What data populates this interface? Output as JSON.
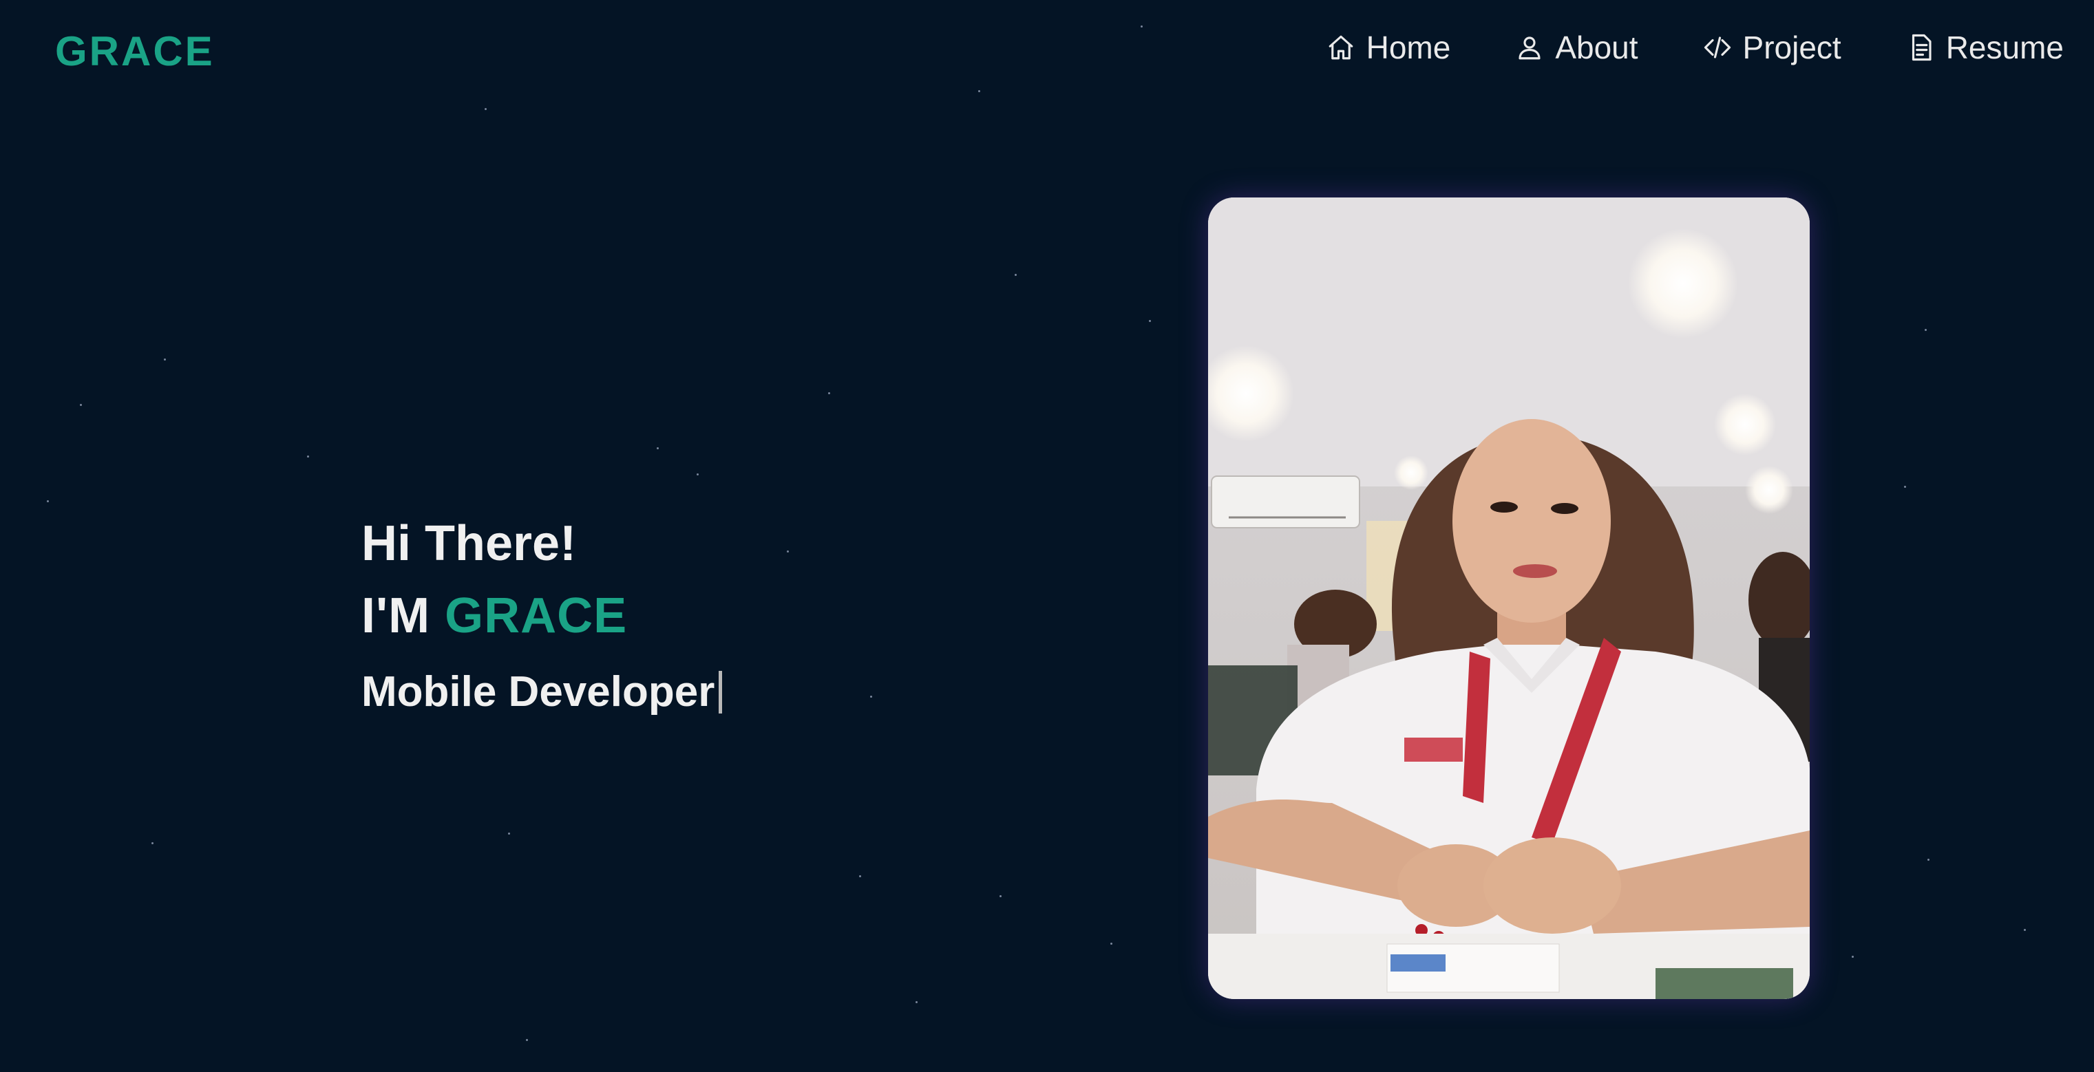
{
  "navbar": {
    "brand": "GRACE",
    "items": [
      {
        "label": "Home",
        "icon": "home-icon"
      },
      {
        "label": "About",
        "icon": "user-icon"
      },
      {
        "label": "Project",
        "icon": "code-icon"
      },
      {
        "label": "Resume",
        "icon": "document-icon"
      }
    ]
  },
  "hero": {
    "greeting": "Hi There!",
    "intro_prefix": "I'M ",
    "name": "GRACE",
    "role": "Mobile Developer"
  },
  "colors": {
    "background": "#041425",
    "accent": "#1aa386",
    "text": "#f0f0f0"
  }
}
